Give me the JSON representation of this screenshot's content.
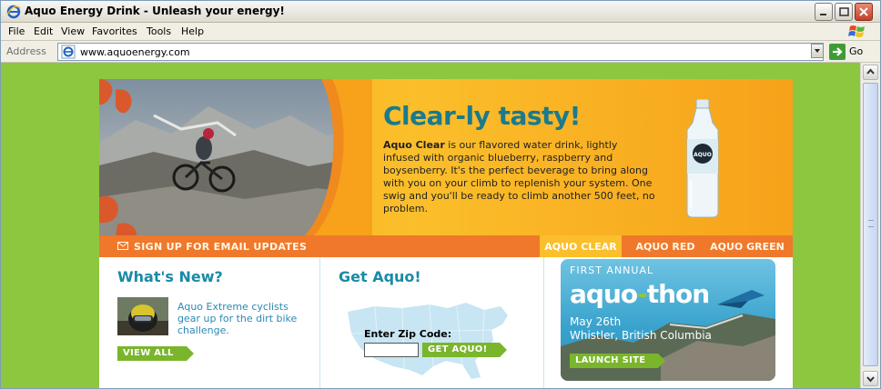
{
  "window": {
    "title": "Aquo Energy Drink - Unleash your energy!"
  },
  "menu": {
    "items": [
      "File",
      "Edit",
      "View",
      "Favorites",
      "Tools",
      "Help"
    ]
  },
  "address": {
    "label": "Address",
    "url": "www.aquoenergy.com",
    "go_label": "Go"
  },
  "hero": {
    "title": "Clear-ly tasty!",
    "product": "Aquo Clear",
    "body": " is our flavored water drink, lightly infused with organic blueberry, raspberry and boysenberry.  It's the perfect beverage to bring along with you on your climb to replenish your system. One swig and you'll be ready to climb another 500 feet, no problem.",
    "bottle_label": "AQUO"
  },
  "nav": {
    "signup": "SIGN UP FOR EMAIL UPDATES",
    "tabs": [
      {
        "label": "AQUO CLEAR",
        "active": true
      },
      {
        "label": "AQUO RED",
        "active": false
      },
      {
        "label": "AQUO GREEN",
        "active": false
      }
    ]
  },
  "whats_new": {
    "title": "What's New?",
    "news_text": "Aquo Extreme cyclists gear up for the dirt bike challenge.",
    "view_all": "VIEW ALL"
  },
  "get_aquo": {
    "title": "Get Aquo!",
    "zip_label": "Enter Zip Code:",
    "zip_value": "",
    "button": "GET AQUO!"
  },
  "promo": {
    "first_annual": "FIRST ANNUAL",
    "name_left": "aquo",
    "name_dash": "-",
    "name_right": "thon",
    "date": "May 26th",
    "place": "Whistler, British Columbia",
    "launch": "LAUNCH SITE"
  },
  "colors": {
    "background_green": "#8dc73f",
    "hero_orange": "#f7a21a",
    "nav_orange": "#f0782a",
    "teal_heading": "#1a7a8e",
    "link_blue": "#2a8ab4",
    "tag_green": "#7ab52b"
  }
}
